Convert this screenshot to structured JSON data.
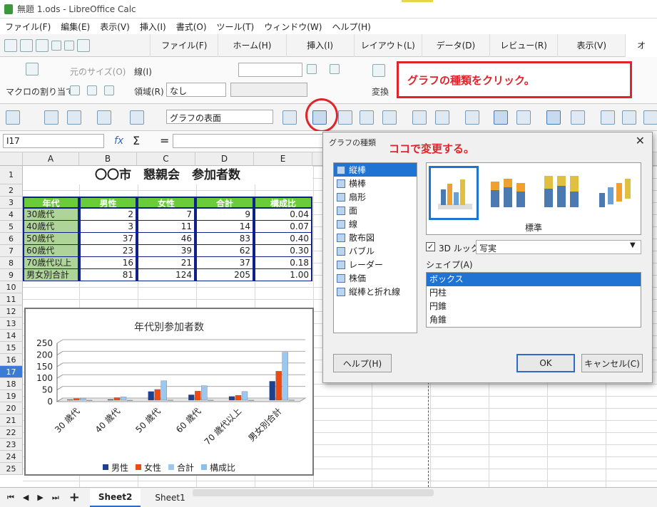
{
  "window": {
    "title": "無題 1.ods - LibreOffice Calc"
  },
  "menu": [
    "ファイル(F)",
    "編集(E)",
    "表示(V)",
    "挿入(I)",
    "書式(O)",
    "ツール(T)",
    "ウィンドウ(W)",
    "ヘルプ(H)"
  ],
  "tabs": [
    "ファイル(F)",
    "ホーム(H)",
    "挿入(I)",
    "レイアウト(L)",
    "データ(D)",
    "レビュー(R)",
    "表示(V)",
    "オ"
  ],
  "ribbon": {
    "macro_label": "マクロの割り当て",
    "original_size": "元のサイズ(O)",
    "line_label": "線(I)",
    "area_label": "領域(R)",
    "area_value": "なし",
    "convert_label": "変換"
  },
  "callout": "グラフの種類をクリック。",
  "toolbar2": {
    "element_select": "グラフの表面"
  },
  "formula": {
    "name_box": "I17",
    "fx": "fx",
    "sum": "Σ",
    "eq": "="
  },
  "sheet": {
    "columns": [
      "A",
      "B",
      "C",
      "D",
      "E"
    ],
    "rows": [
      "1",
      "2",
      "3",
      "4",
      "5",
      "6",
      "7",
      "8",
      "9",
      "10",
      "11",
      "12",
      "13",
      "14",
      "15",
      "16",
      "17",
      "18",
      "19",
      "20",
      "21",
      "22",
      "23",
      "24",
      "25"
    ],
    "title": "〇〇市　懇親会　参加者数",
    "headers": [
      "年代",
      "男性",
      "女性",
      "合計",
      "構成比"
    ],
    "data": [
      [
        "30歳代",
        "2",
        "7",
        "9",
        "0.04"
      ],
      [
        "40歳代",
        "3",
        "11",
        "14",
        "0.07"
      ],
      [
        "50歳代",
        "37",
        "46",
        "83",
        "0.40"
      ],
      [
        "60歳代",
        "23",
        "39",
        "62",
        "0.30"
      ],
      [
        "70歳代以上",
        "16",
        "21",
        "37",
        "0.18"
      ],
      [
        "男女別合計",
        "81",
        "124",
        "205",
        "1.00"
      ]
    ]
  },
  "chart_data": {
    "type": "bar",
    "title": "年代別参加者数",
    "categories": [
      "30 歳代",
      "40 歳代",
      "50 歳代",
      "60 歳代",
      "70 歳代以上",
      "男女別合計"
    ],
    "series": [
      {
        "name": "男性",
        "values": [
          2,
          3,
          37,
          23,
          16,
          81
        ],
        "color": "#1f3f8f"
      },
      {
        "name": "女性",
        "values": [
          7,
          11,
          46,
          39,
          21,
          124
        ],
        "color": "#f04a10"
      },
      {
        "name": "合計",
        "values": [
          9,
          14,
          83,
          62,
          37,
          205
        ],
        "color": "#9cc8f0"
      },
      {
        "name": "構成比",
        "values": [
          0.04,
          0.07,
          0.4,
          0.3,
          0.18,
          1.0
        ],
        "color": "#8ac0ee"
      }
    ],
    "yticks": [
      "0",
      "50",
      "100",
      "150",
      "200",
      "250"
    ],
    "ylim": [
      0,
      250
    ],
    "grid": true,
    "legend": "bottom"
  },
  "dialog": {
    "title": "グラフの種類",
    "annotation": "ココで変更する。",
    "types": [
      "縦棒",
      "横棒",
      "扇形",
      "面",
      "線",
      "散布図",
      "バブル",
      "レーダー",
      "株価",
      "縦棒と折れ線"
    ],
    "variant_label": "標準",
    "look3d_label": "3D ルック",
    "look3d_value": "写実",
    "shape_label": "シェイプ(A)",
    "shapes": [
      "ボックス",
      "円柱",
      "円錐",
      "角錐"
    ],
    "help": "ヘルプ(H)",
    "ok": "OK",
    "cancel": "キャンセル(C)"
  },
  "sheet_tabs": [
    "Sheet2",
    "Sheet1"
  ]
}
